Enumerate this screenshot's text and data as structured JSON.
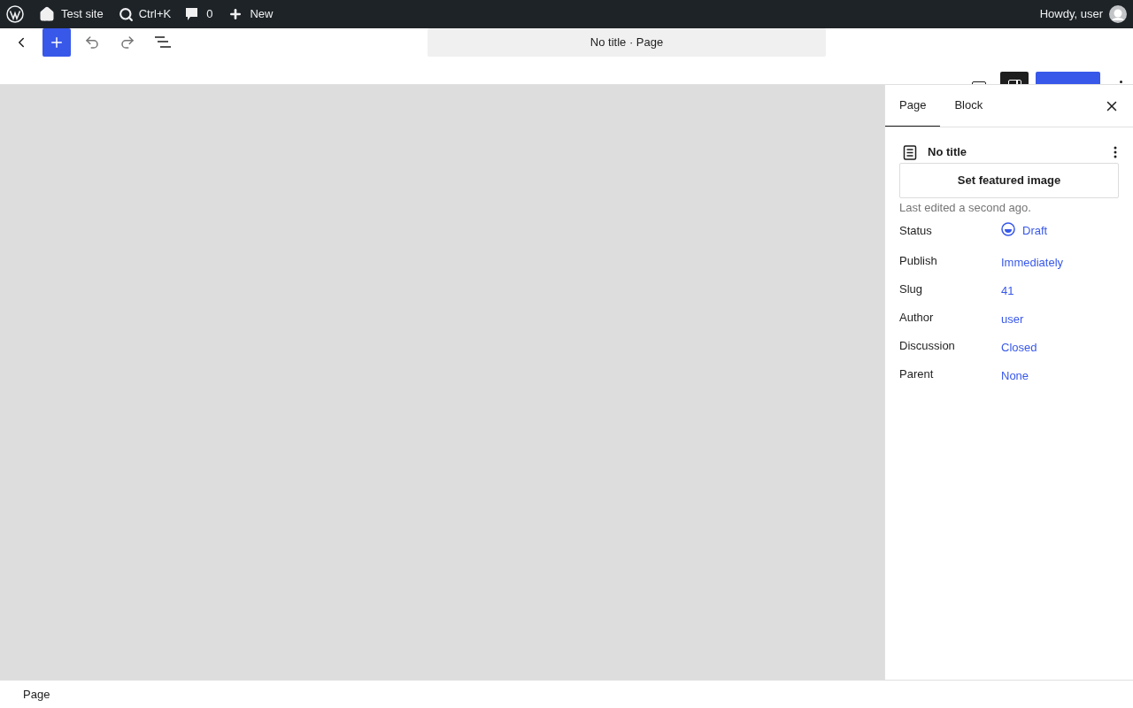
{
  "admin_bar": {
    "site": "Test site",
    "search": "Ctrl+K",
    "comments": "0",
    "new": "New",
    "greeting": "Howdy, user"
  },
  "header": {
    "document_title": "No title · Page",
    "settings_toggle": {
      "pressed": true
    }
  },
  "sidebar": {
    "tabs": [
      {
        "label": "Page",
        "selected": true
      },
      {
        "label": "Block",
        "selected": false
      }
    ],
    "post_title": "No title",
    "featured_image_button": "Set featured image",
    "last_edited": "Last edited a second ago.",
    "fields": [
      {
        "kind": "status",
        "label": "Status",
        "value": "Draft"
      },
      {
        "kind": "link",
        "label": "Publish",
        "value": "Immediately"
      },
      {
        "kind": "link",
        "label": "Slug",
        "value": "41"
      },
      {
        "kind": "link",
        "label": "Author",
        "value": "user"
      },
      {
        "kind": "link",
        "label": "Discussion",
        "value": "Closed"
      },
      {
        "kind": "link",
        "label": "Parent",
        "value": "None"
      }
    ]
  },
  "footer": {
    "breadcrumb": "Page"
  }
}
